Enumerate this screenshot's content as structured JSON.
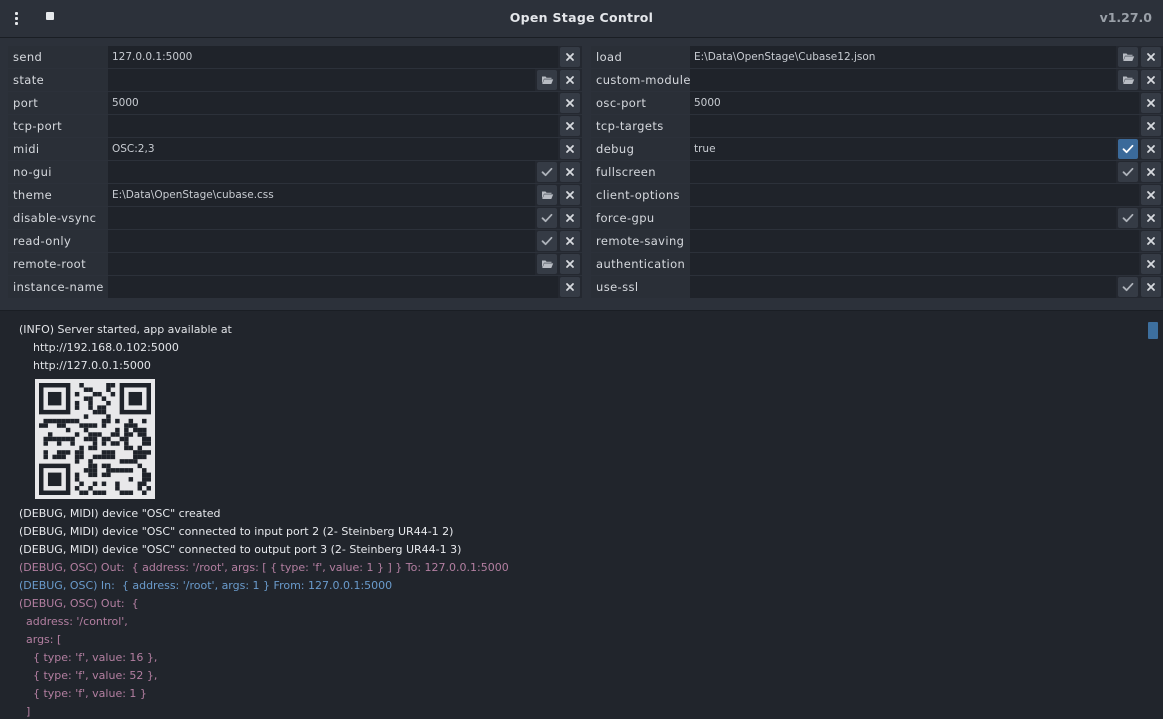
{
  "titlebar": {
    "title": "Open Stage Control",
    "version": "v1.27.0",
    "icons": {
      "menu": "kebab-menu-icon",
      "stop": "stop-icon"
    }
  },
  "config": {
    "left": [
      {
        "key": "send",
        "value": "127.0.0.1:5000",
        "buttons": [
          "clear"
        ]
      },
      {
        "key": "state",
        "value": "",
        "buttons": [
          "browse",
          "clear"
        ]
      },
      {
        "key": "port",
        "value": "5000",
        "buttons": [
          "clear"
        ]
      },
      {
        "key": "tcp-port",
        "value": "",
        "buttons": [
          "clear"
        ]
      },
      {
        "key": "midi",
        "value": "OSC:2,3",
        "buttons": [
          "clear"
        ]
      },
      {
        "key": "no-gui",
        "value": "",
        "buttons": [
          "check",
          "clear"
        ]
      },
      {
        "key": "theme",
        "value": "E:\\Data\\OpenStage\\cubase.css",
        "buttons": [
          "browse",
          "clear"
        ]
      },
      {
        "key": "disable-vsync",
        "value": "",
        "buttons": [
          "check",
          "clear"
        ]
      },
      {
        "key": "read-only",
        "value": "",
        "buttons": [
          "check",
          "clear"
        ]
      },
      {
        "key": "remote-root",
        "value": "",
        "buttons": [
          "browse",
          "clear"
        ]
      },
      {
        "key": "instance-name",
        "value": "",
        "buttons": [
          "clear"
        ]
      }
    ],
    "right": [
      {
        "key": "load",
        "value": "E:\\Data\\OpenStage\\Cubase12.json",
        "buttons": [
          "browse",
          "clear"
        ]
      },
      {
        "key": "custom-module",
        "value": "",
        "buttons": [
          "browse",
          "clear"
        ]
      },
      {
        "key": "osc-port",
        "value": "5000",
        "buttons": [
          "clear"
        ]
      },
      {
        "key": "tcp-targets",
        "value": "",
        "buttons": [
          "clear"
        ]
      },
      {
        "key": "debug",
        "value": "true",
        "buttons": [
          "check-on",
          "clear"
        ]
      },
      {
        "key": "fullscreen",
        "value": "",
        "buttons": [
          "check",
          "clear"
        ]
      },
      {
        "key": "client-options",
        "value": "",
        "buttons": [
          "clear"
        ]
      },
      {
        "key": "force-gpu",
        "value": "",
        "buttons": [
          "check",
          "clear"
        ]
      },
      {
        "key": "remote-saving",
        "value": "",
        "buttons": [
          "clear"
        ]
      },
      {
        "key": "authentication",
        "value": "",
        "buttons": [
          "clear"
        ]
      },
      {
        "key": "use-ssl",
        "value": "",
        "buttons": [
          "check",
          "clear"
        ]
      }
    ]
  },
  "console": {
    "lines": [
      {
        "text": "(INFO) Server started, app available at",
        "type": "info"
      },
      {
        "text": "    http://192.168.0.102:5000",
        "type": "info"
      },
      {
        "text": "    http://127.0.0.1:5000",
        "type": "info"
      },
      {
        "text": "__QR__",
        "type": "qr"
      },
      {
        "text": "(DEBUG, MIDI) device \"OSC\" created",
        "type": "dbg-midi"
      },
      {
        "text": "(DEBUG, MIDI) device \"OSC\" connected to input port 2 (2- Steinberg UR44-1 2)",
        "type": "dbg-midi"
      },
      {
        "text": "(DEBUG, MIDI) device \"OSC\" connected to output port 3 (2- Steinberg UR44-1 3)",
        "type": "dbg-midi"
      },
      {
        "text": "(DEBUG, OSC) Out:  { address: '/root', args: [ { type: 'f', value: 1 } ] } To: 127.0.0.1:5000",
        "type": "osc-out"
      },
      {
        "text": "(DEBUG, OSC) In:  { address: '/root', args: 1 } From: 127.0.0.1:5000",
        "type": "osc-in"
      },
      {
        "text": "(DEBUG, OSC) Out:  {",
        "type": "osc-out"
      },
      {
        "text": "  address: '/control',",
        "type": "osc-out"
      },
      {
        "text": "  args: [",
        "type": "osc-out"
      },
      {
        "text": "    { type: 'f', value: 16 },",
        "type": "osc-out"
      },
      {
        "text": "    { type: 'f', value: 52 },",
        "type": "osc-out"
      },
      {
        "text": "    { type: 'f', value: 1 }",
        "type": "osc-out"
      },
      {
        "text": "  ]",
        "type": "osc-out"
      }
    ]
  },
  "colors": {
    "accent": "#3b6a9a",
    "osc_out": "#b37fa1",
    "osc_in": "#6a9bcc"
  }
}
